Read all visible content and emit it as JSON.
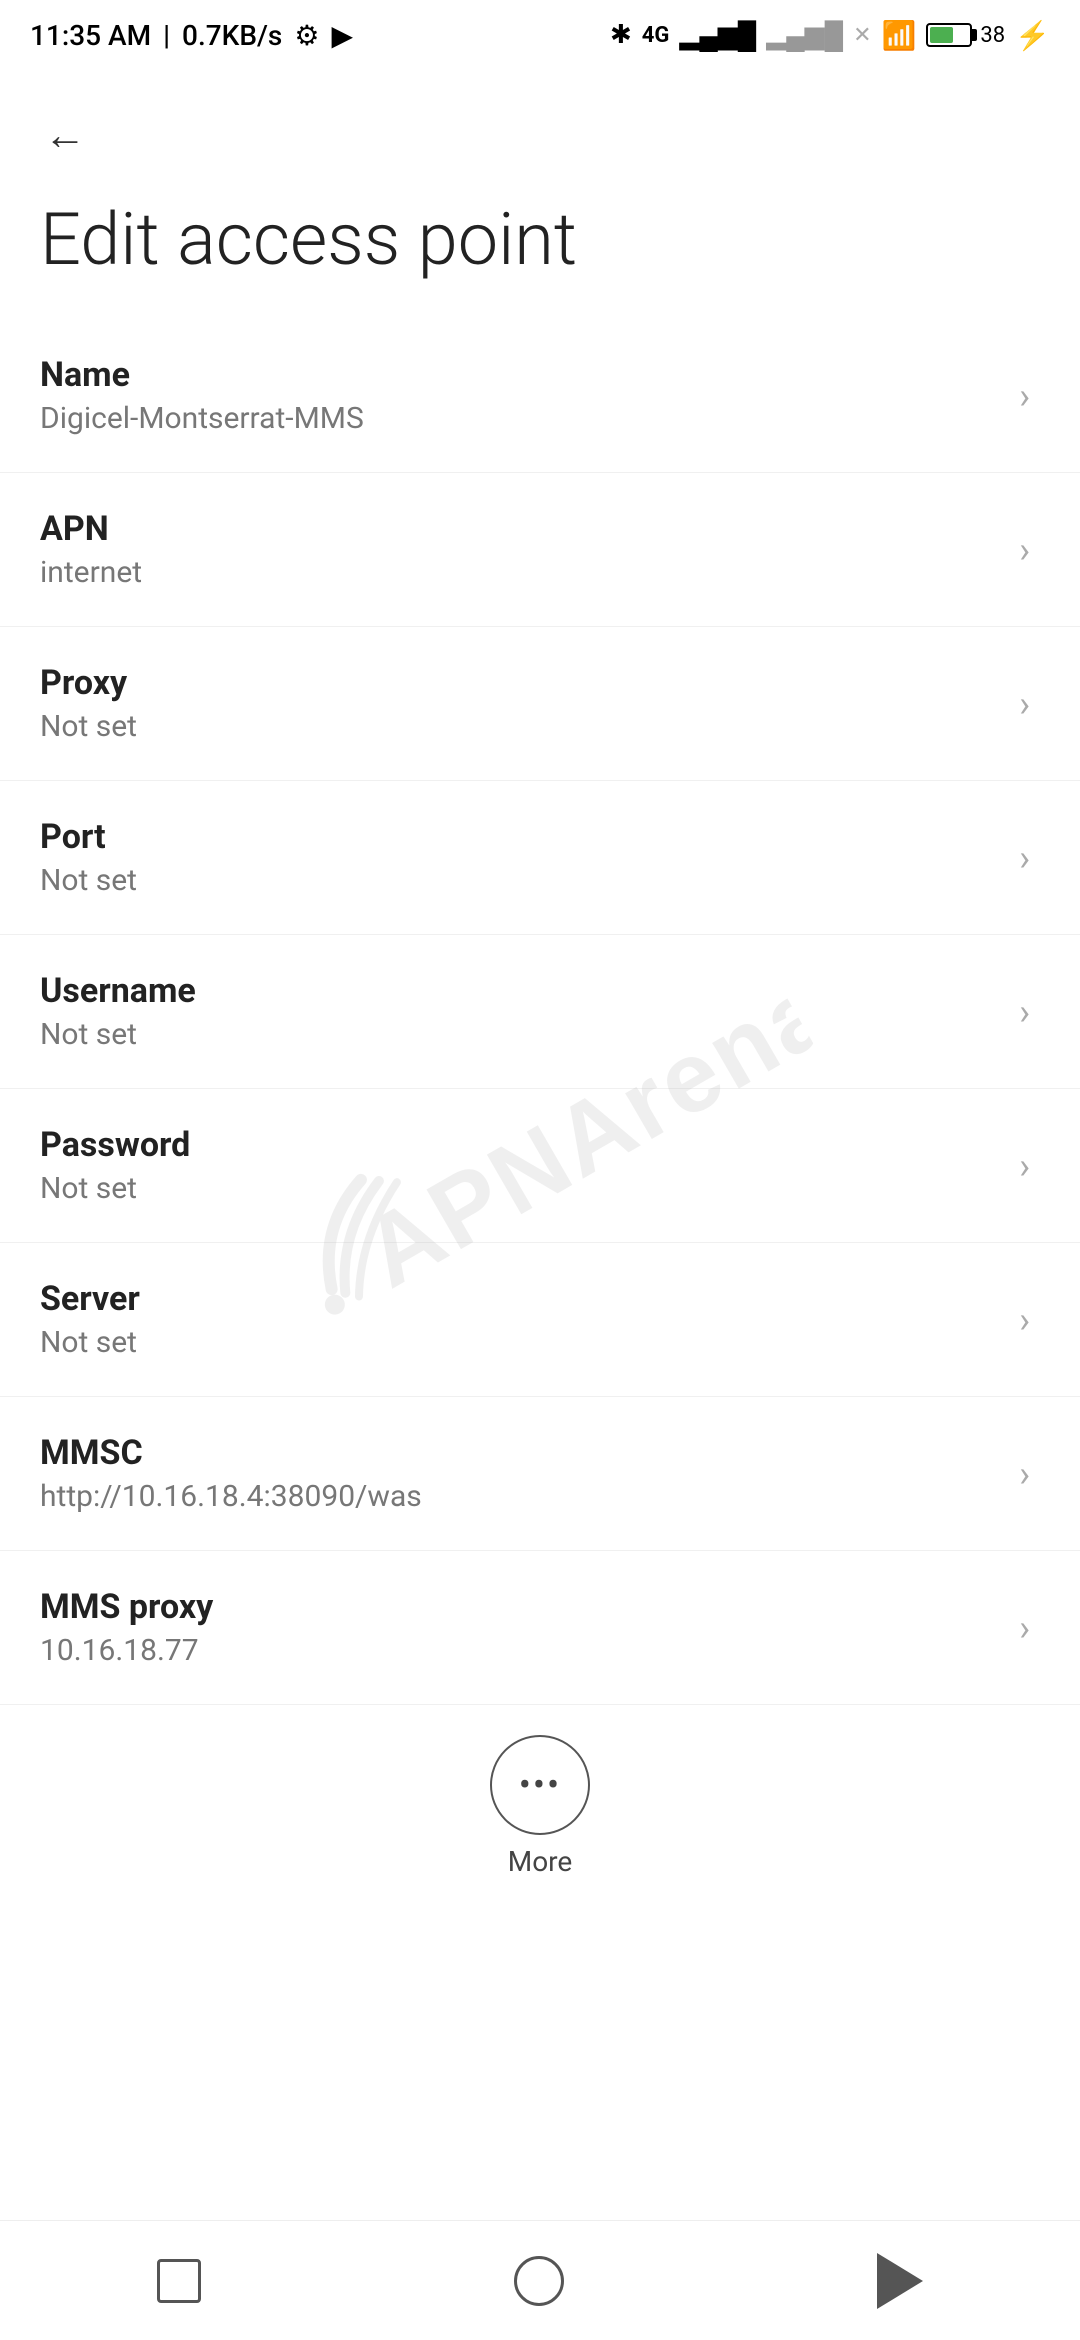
{
  "statusBar": {
    "time": "11:35 AM",
    "speed": "0.7KB/s"
  },
  "pageTitle": "Edit access point",
  "backButton": "←",
  "settings": [
    {
      "label": "Name",
      "value": "Digicel-Montserrat-MMS"
    },
    {
      "label": "APN",
      "value": "internet"
    },
    {
      "label": "Proxy",
      "value": "Not set"
    },
    {
      "label": "Port",
      "value": "Not set"
    },
    {
      "label": "Username",
      "value": "Not set"
    },
    {
      "label": "Password",
      "value": "Not set"
    },
    {
      "label": "Server",
      "value": "Not set"
    },
    {
      "label": "MMSC",
      "value": "http://10.16.18.4:38090/was"
    },
    {
      "label": "MMS proxy",
      "value": "10.16.18.77"
    }
  ],
  "more": {
    "label": "More"
  },
  "watermark": "APNArena"
}
